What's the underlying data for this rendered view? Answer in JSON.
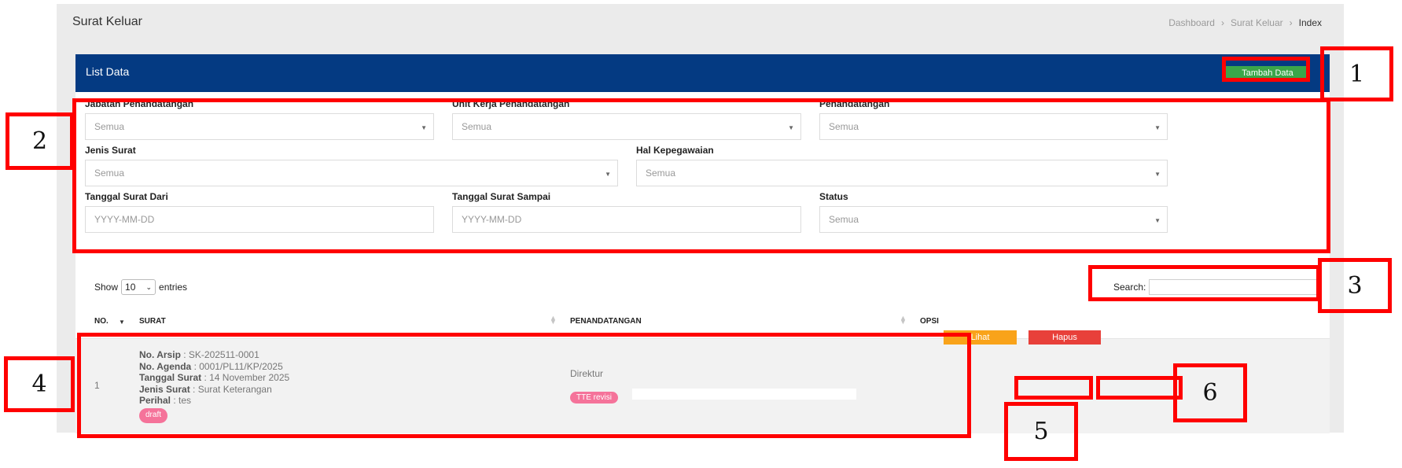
{
  "page": {
    "title": "Surat Keluar",
    "breadcrumb": [
      "Dashboard",
      "Surat Keluar",
      "Index"
    ]
  },
  "card": {
    "title": "List Data",
    "add_button": "Tambah Data"
  },
  "filters": {
    "jabatan": {
      "label": "Jabatan Penandatangan",
      "value": "Semua"
    },
    "unit_kerja": {
      "label": "Unit Kerja Penandatangan",
      "value": "Semua"
    },
    "penandatangan": {
      "label": "Penandatangan",
      "value": "Semua"
    },
    "jenis_surat": {
      "label": "Jenis Surat",
      "value": "Semua"
    },
    "hal_kepegawaian": {
      "label": "Hal Kepegawaian",
      "value": "Semua"
    },
    "tanggal_dari": {
      "label": "Tanggal Surat Dari",
      "placeholder": "YYYY-MM-DD"
    },
    "tanggal_sampai": {
      "label": "Tanggal Surat Sampai",
      "placeholder": "YYYY-MM-DD"
    },
    "status": {
      "label": "Status",
      "value": "Semua"
    }
  },
  "table_controls": {
    "show_label": "Show",
    "entries_value": "10",
    "entries_label": "entries",
    "search_label": "Search:",
    "search_value": ""
  },
  "table": {
    "columns": [
      "NO.",
      "SURAT",
      "PENANDATANGAN",
      "OPSI"
    ],
    "rows": [
      {
        "no": "1",
        "no_arsip_label": "No. Arsip",
        "no_arsip": " : SK-202511-0001",
        "no_agenda_label": "No. Agenda",
        "no_agenda": " : 0001/PL11/KP/2025",
        "tanggal_label": "Tanggal Surat",
        "tanggal": " : 14 November 2025",
        "jenis_label": "Jenis Surat",
        "jenis": " : Surat Keterangan",
        "perihal_label": "Perihal",
        "perihal": " : tes",
        "status_badge": "draft",
        "penandatangan_jabatan": "Direktur",
        "tte_badge": "TTE revisi",
        "lihat_button": "Lihat",
        "hapus_button": "Hapus"
      }
    ]
  },
  "annotations": [
    "1",
    "2",
    "3",
    "4",
    "5",
    "6"
  ],
  "colors": {
    "header_blue": "#043a82",
    "add_green": "#3aa64a",
    "lihat_orange": "#f9a31a",
    "hapus_red": "#e8403a",
    "badge_pink": "#f5739a",
    "annotation_red": "#ff0000"
  }
}
